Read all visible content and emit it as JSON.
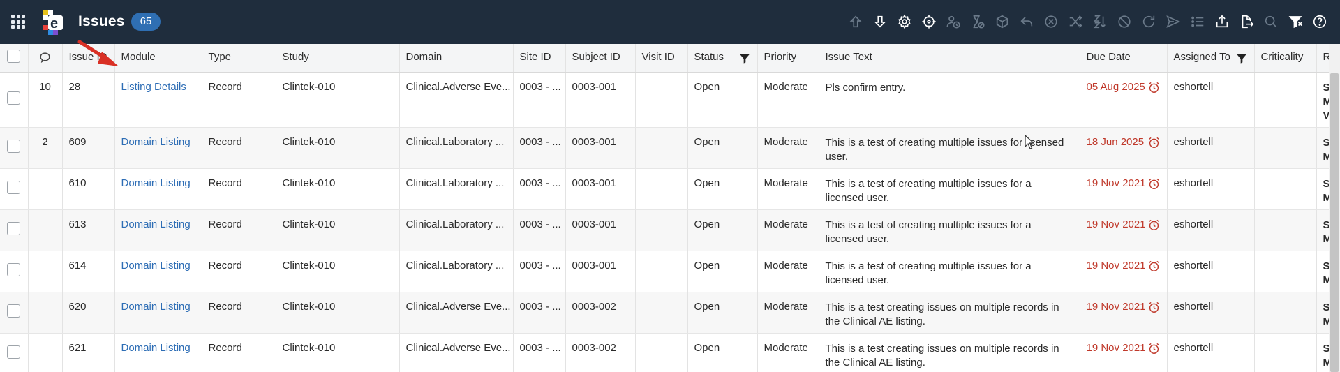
{
  "header": {
    "title": "Issues",
    "count": "65",
    "toolbar_icons": [
      "arrow-up-icon",
      "arrow-down-icon",
      "gear-icon",
      "crosshair-icon",
      "user-clock-icon",
      "hourglass-icon",
      "cube-icon",
      "reply-icon",
      "cancel-circle-icon",
      "shuffle-icon",
      "sort-az-icon",
      "ban-icon",
      "refresh-icon",
      "send-icon",
      "list-icon",
      "export-icon",
      "file-export-icon",
      "search-icon",
      "filter-icon",
      "help-icon"
    ]
  },
  "colors": {
    "header_bg": "#1f2d3d",
    "badge_bg": "#2f6fb3",
    "link": "#2d6db5",
    "due_date": "#c0392b",
    "annotation_arrow": "#d93025"
  },
  "columns": {
    "comments_icon": "comment-icon",
    "issue": "Issue ID",
    "module": "Module",
    "type": "Type",
    "study": "Study",
    "domain": "Domain",
    "site": "Site ID",
    "subject": "Subject ID",
    "visit": "Visit ID",
    "status": "Status",
    "priority": "Priority",
    "issue_text": "Issue Text",
    "due_date": "Due Date",
    "assigned_to": "Assigned To",
    "criticality": "Criticality",
    "last": "R"
  },
  "rows": [
    {
      "comments": "10",
      "issue": "28",
      "module": "Listing Details",
      "type": "Record",
      "study": "Clintek-010",
      "domain": "Clinical.Adverse Eve...",
      "site": "0003 - ...",
      "subject": "0003-001",
      "visit": "",
      "status": "Open",
      "priority": "Moderate",
      "text": "Pls confirm entry.",
      "due": "05 Aug 2025",
      "assigned": "eshortell",
      "criticality": "",
      "last": "S M V"
    },
    {
      "comments": "2",
      "issue": "609",
      "module": "Domain Listing",
      "type": "Record",
      "study": "Clintek-010",
      "domain": "Clinical.Laboratory ...",
      "site": "0003 - ...",
      "subject": "0003-001",
      "visit": "",
      "status": "Open",
      "priority": "Moderate",
      "text": "This is a test of creating multiple issues for licensed user.",
      "due": "18 Jun 2025",
      "assigned": "eshortell",
      "criticality": "",
      "last": "S M"
    },
    {
      "comments": "",
      "issue": "610",
      "module": "Domain Listing",
      "type": "Record",
      "study": "Clintek-010",
      "domain": "Clinical.Laboratory ...",
      "site": "0003 - ...",
      "subject": "0003-001",
      "visit": "",
      "status": "Open",
      "priority": "Moderate",
      "text": "This is a test of creating multiple issues for a licensed user.",
      "due": "19 Nov 2021",
      "assigned": "eshortell",
      "criticality": "",
      "last": "S M"
    },
    {
      "comments": "",
      "issue": "613",
      "module": "Domain Listing",
      "type": "Record",
      "study": "Clintek-010",
      "domain": "Clinical.Laboratory ...",
      "site": "0003 - ...",
      "subject": "0003-001",
      "visit": "",
      "status": "Open",
      "priority": "Moderate",
      "text": "This is a test of creating multiple issues for a licensed user.",
      "due": "19 Nov 2021",
      "assigned": "eshortell",
      "criticality": "",
      "last": "S M"
    },
    {
      "comments": "",
      "issue": "614",
      "module": "Domain Listing",
      "type": "Record",
      "study": "Clintek-010",
      "domain": "Clinical.Laboratory ...",
      "site": "0003 - ...",
      "subject": "0003-001",
      "visit": "",
      "status": "Open",
      "priority": "Moderate",
      "text": "This is a test of creating multiple issues for a licensed user.",
      "due": "19 Nov 2021",
      "assigned": "eshortell",
      "criticality": "",
      "last": "S M"
    },
    {
      "comments": "",
      "issue": "620",
      "module": "Domain Listing",
      "type": "Record",
      "study": "Clintek-010",
      "domain": "Clinical.Adverse Eve...",
      "site": "0003 - ...",
      "subject": "0003-002",
      "visit": "",
      "status": "Open",
      "priority": "Moderate",
      "text": "This is a test creating issues on multiple records in the Clinical AE listing.",
      "due": "19 Nov 2021",
      "assigned": "eshortell",
      "criticality": "",
      "last": "S M"
    },
    {
      "comments": "",
      "issue": "621",
      "module": "Domain Listing",
      "type": "Record",
      "study": "Clintek-010",
      "domain": "Clinical.Adverse Eve...",
      "site": "0003 - ...",
      "subject": "0003-002",
      "visit": "",
      "status": "Open",
      "priority": "Moderate",
      "text": "This is a test creating issues on multiple records in the Clinical AE listing.",
      "due": "19 Nov 2021",
      "assigned": "eshortell",
      "criticality": "",
      "last": "S M"
    }
  ]
}
